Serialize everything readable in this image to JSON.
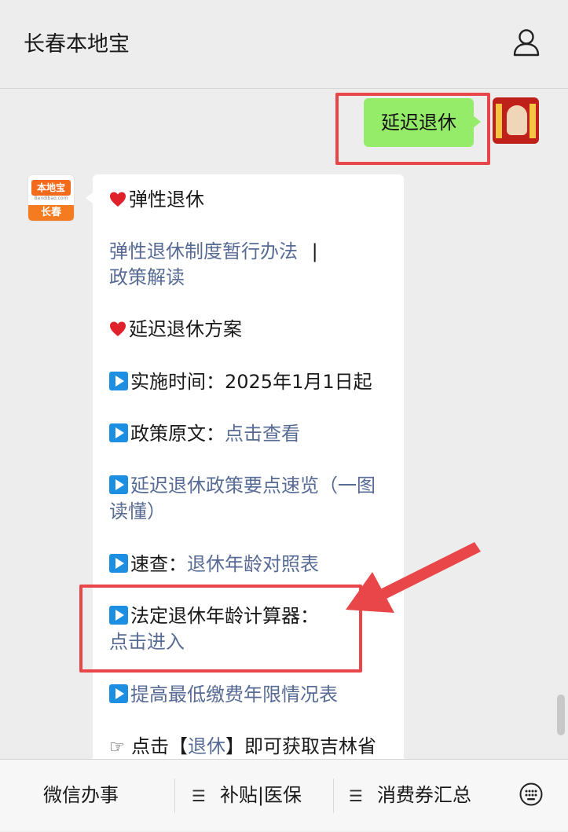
{
  "header": {
    "title": "长春本地宝",
    "profile_icon": "person-icon"
  },
  "outgoing": {
    "text": "延迟退休"
  },
  "bot_avatar": {
    "logo_text": "本地宝",
    "sub_text": "Bendibao.com",
    "city": "长春"
  },
  "message": {
    "sec1_title": "弹性退休",
    "sec1_link1": "弹性退休制度暂行办法",
    "sec1_sep": "|",
    "sec1_link2": "政策解读",
    "sec2_title": "延迟退休方案",
    "item1": "实施时间：2025年1月1日起",
    "item2_label": "政策原文：",
    "item2_link": "点击查看",
    "item3_link_a": "延迟退休政策要点速览（一图",
    "item3_link_b": "读懂）",
    "item4_label": "速查：",
    "item4_link": "退休年龄对照表",
    "item5_label": "法定退休年龄计算器：",
    "item5_link": "点击进入",
    "item6_link": "提高最低缴费年限情况表",
    "item7_prefix": "点击【",
    "item7_link": "退休",
    "item7_suffix": "】即可获取吉林省"
  },
  "menu": {
    "item1": "微信办事",
    "item2": "补贴|医保",
    "item3": "消费券汇总",
    "hamburger": "☰",
    "keyboard_icon": "keyboard-icon"
  },
  "colors": {
    "accent_green": "#95ec69",
    "link_blue": "#576b95",
    "highlight_red": "#e9464a"
  }
}
